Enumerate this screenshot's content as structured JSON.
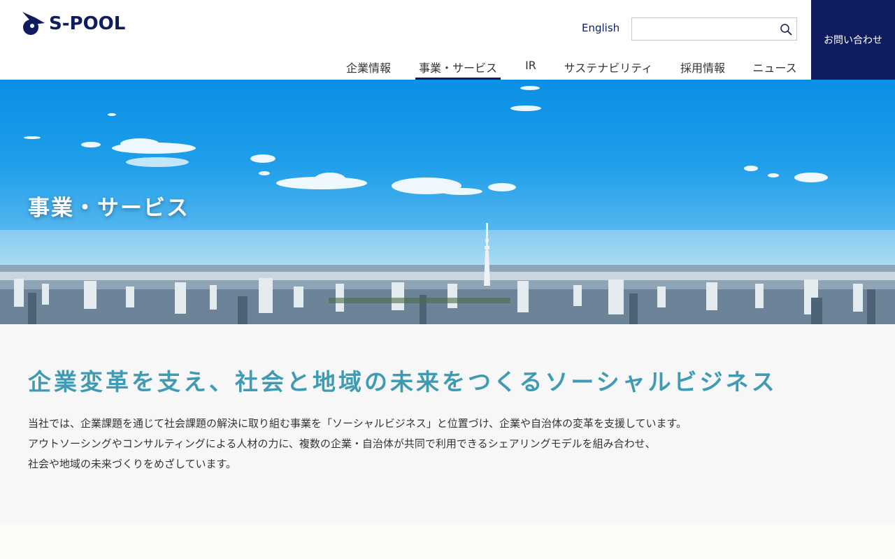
{
  "header": {
    "logo_text": "S-POOL",
    "lang_link": "English",
    "search_placeholder": "",
    "contact_label": "お問い合わせ"
  },
  "nav": {
    "items": [
      {
        "label": "企業情報"
      },
      {
        "label": "事業・サービス",
        "active": true
      },
      {
        "label": "IR"
      },
      {
        "label": "サステナビリティ"
      },
      {
        "label": "採用情報"
      },
      {
        "label": "ニュース"
      }
    ]
  },
  "hero": {
    "title": "事業・サービス"
  },
  "intro": {
    "heading": "企業変革を支え、社会と地域の未来をつくるソーシャルビジネス",
    "lines": [
      "当社では、企業課題を通じて社会課題の解決に取り組む事業を「ソーシャルビジネス」と位置づけ、企業や自治体の変革を支援しています。",
      "アウトソーシングやコンサルティングによる人材の力に、複数の企業・自治体が共同で利用できるシェアリングモデルを組み合わせ、",
      "社会や地域の未来づくりをめざしています。"
    ]
  },
  "colors": {
    "brand_navy": "#0f1d60",
    "heading_teal": "#3f9bb4",
    "section_bg": "#f7f7f7"
  },
  "icons": {
    "search": "search-icon",
    "logo": "logo-mark-icon"
  }
}
